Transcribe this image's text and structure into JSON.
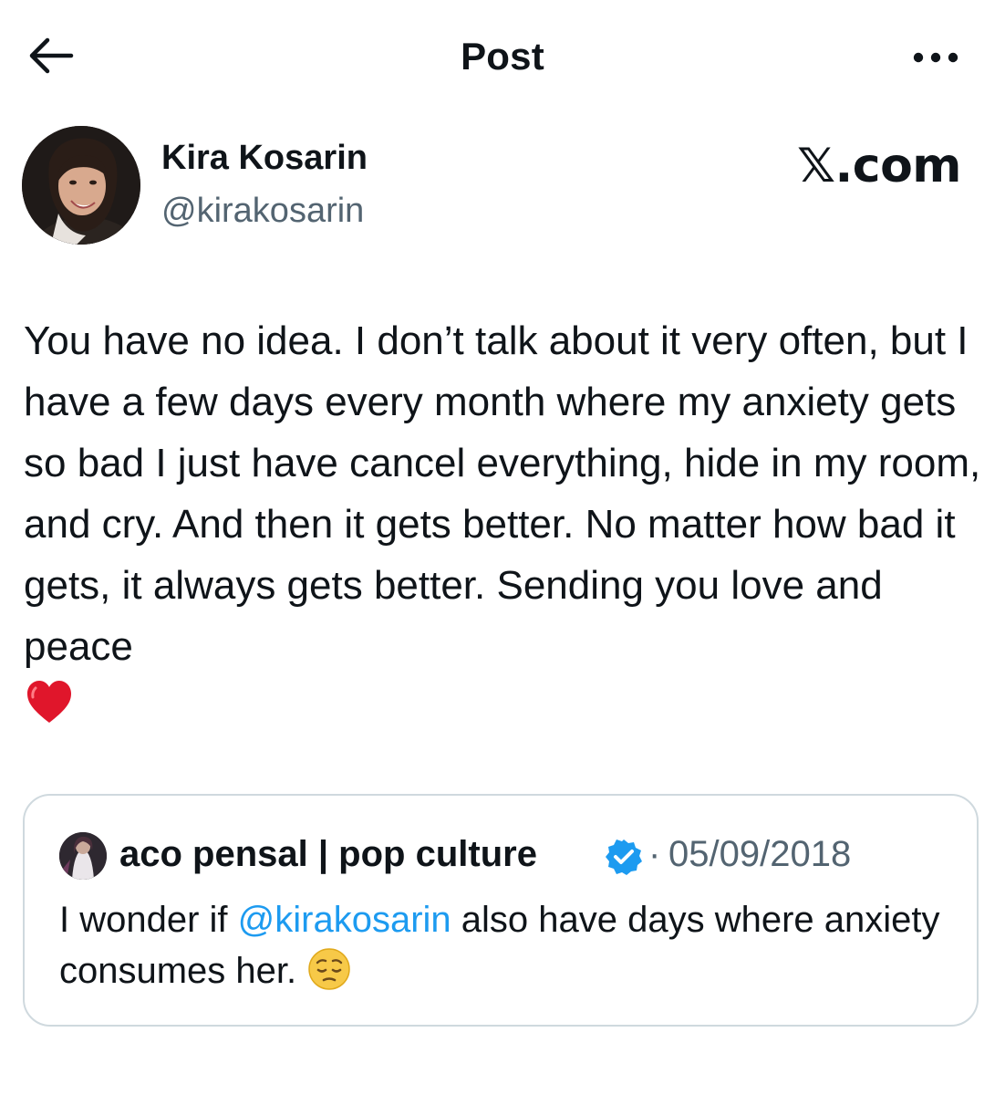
{
  "header": {
    "title": "Post",
    "back_icon": "arrow-left-icon",
    "more_icon": "more-horizontal-icon"
  },
  "author": {
    "name": "Kira Kosarin",
    "handle": "@kirakosarin"
  },
  "watermark": "𝕏.com",
  "post": {
    "text": "You have no idea. I don’t talk about it very often, but I have a few days every month where my anxiety gets so bad I just have cancel everything, hide in my room, and cry. And then it gets better. No matter how bad it gets, it always gets better. Sending you love and peace",
    "emoji": "red-heart-emoji"
  },
  "quote": {
    "name": "aco pensal | pop culture",
    "verified": true,
    "separator": "·",
    "date": "05/09/2018",
    "text_before": "I wonder if ",
    "mention": "@kirakosarin",
    "text_after": " also have days where anxiety consumes her. ",
    "emoji": "pensive-face-emoji"
  },
  "colors": {
    "text": "#0f1419",
    "secondary": "#536471",
    "link": "#1d9bf0",
    "border": "#cfd9de",
    "verified": "#1d9bf0",
    "heart": "#e0162b"
  }
}
